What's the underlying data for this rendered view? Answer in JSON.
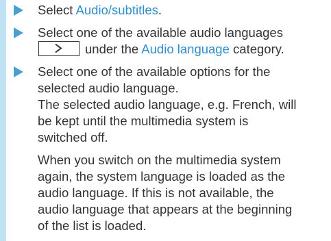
{
  "colors": {
    "accent": "#2f8fcc",
    "arrow": "#4a9fd1",
    "side_bar": "#bfe2f4",
    "text": "#333333"
  },
  "icons": {
    "step_bullet": "arrow-right-icon",
    "next_key": "chevron-right-icon"
  },
  "steps": [
    {
      "prefix": "Select ",
      "link": "Audio/subtitles",
      "suffix": "."
    },
    {
      "line1": "Select one of the available audio languages",
      "line2_before": "under the ",
      "line2_link": "Audio language",
      "line2_after": " category."
    },
    {
      "line1": "Select one of the available options for the",
      "line2": "selected audio language."
    }
  ],
  "notes": {
    "p1": [
      "The selected audio language, e.g. French, will",
      "be kept until the multimedia system is",
      "switched off."
    ],
    "p2": [
      "When you switch on the multimedia system",
      "again, the system language is loaded as the",
      "audio language. If this is not available, the",
      "audio language that appears at the beginning",
      "of the list is loaded."
    ]
  }
}
